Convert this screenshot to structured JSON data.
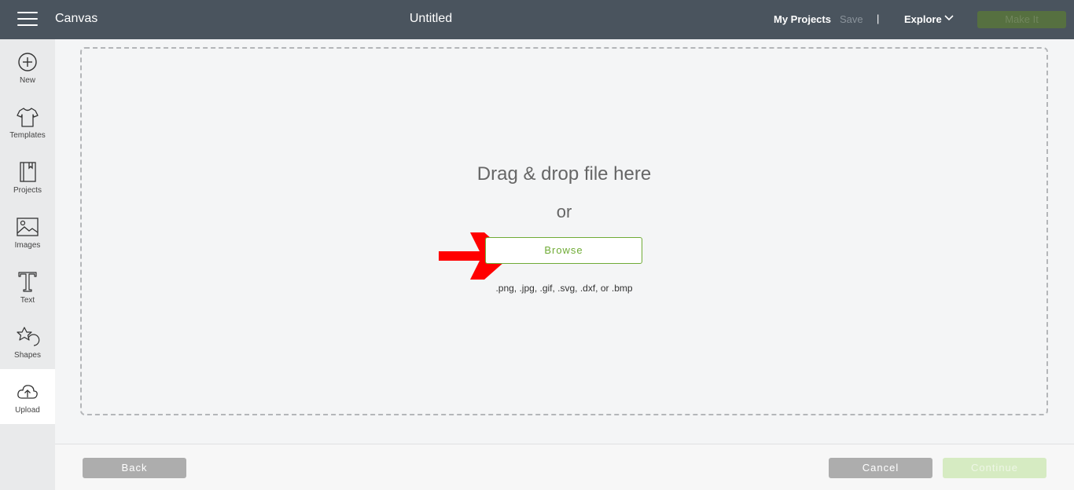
{
  "header": {
    "app_title": "Canvas",
    "doc_title": "Untitled",
    "my_projects": "My Projects",
    "save": "Save",
    "separator": "|",
    "explore": "Explore",
    "make_it": "Make It"
  },
  "sidebar": {
    "items": [
      {
        "label": "New",
        "icon": "plus-circle-icon"
      },
      {
        "label": "Templates",
        "icon": "tshirt-icon"
      },
      {
        "label": "Projects",
        "icon": "notebook-icon"
      },
      {
        "label": "Images",
        "icon": "image-icon"
      },
      {
        "label": "Text",
        "icon": "text-t-icon"
      },
      {
        "label": "Shapes",
        "icon": "shapes-icon"
      },
      {
        "label": "Upload",
        "icon": "cloud-upload-icon",
        "active": true
      }
    ]
  },
  "upload": {
    "drag_text": "Drag & drop file here",
    "or_text": "or",
    "browse_label": "Browse",
    "formats": ".png, .jpg, .gif, .svg, .dxf, or .bmp"
  },
  "footer": {
    "back": "Back",
    "cancel": "Cancel",
    "continue": "Continue"
  },
  "colors": {
    "header_bg": "#4a545e",
    "accent_green": "#6fab35",
    "arrow_red": "#ff0000"
  }
}
